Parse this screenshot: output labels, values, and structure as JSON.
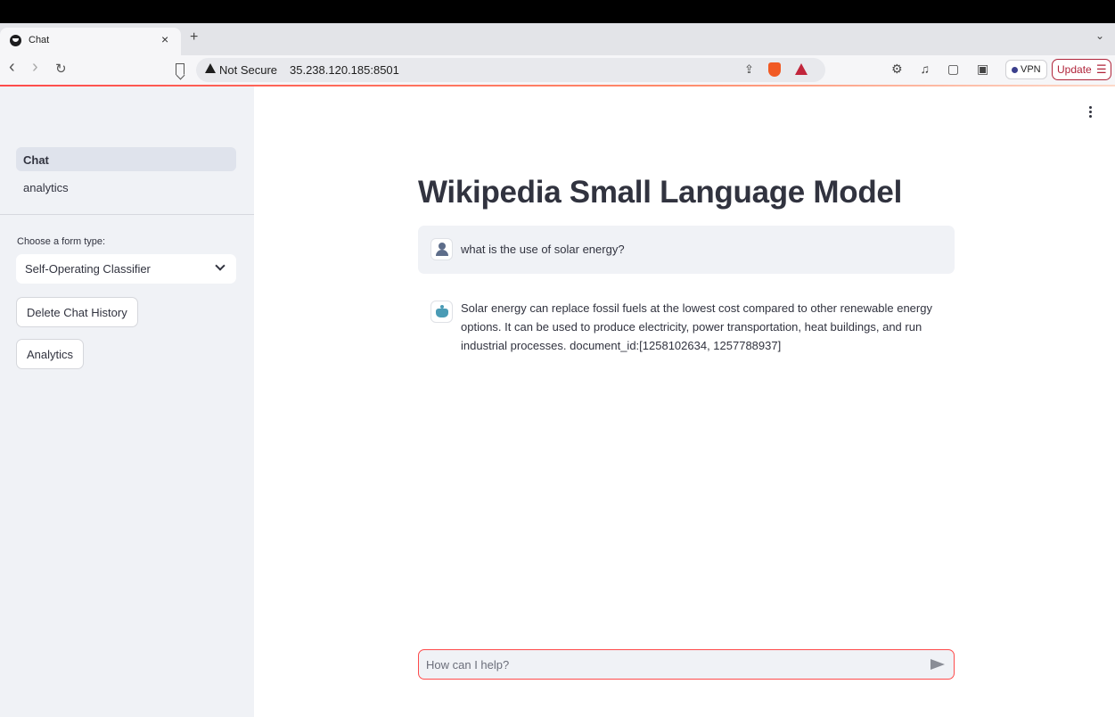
{
  "browser": {
    "tab_title": "Chat",
    "tab_close": "×",
    "new_tab": "+",
    "tab_list": "⌄",
    "back": "‹",
    "forward": "›",
    "reload": "↻",
    "security_label": "Not Secure",
    "url": "35.238.120.185:8501",
    "share": "⇪",
    "extensions": "⚙ ♫ ▢ ▣ ✧",
    "vpn_label": "VPN",
    "update_label": "Update",
    "update_menu": "☰"
  },
  "sidebar": {
    "nav_items": [
      {
        "label": "Chat",
        "active": true
      },
      {
        "label": "analytics",
        "active": false
      }
    ],
    "select_label": "Choose a form type:",
    "select_value": "Self-Operating Classifier",
    "delete_button": "Delete Chat History",
    "analytics_button": "Analytics"
  },
  "main": {
    "title": "Wikipedia Small Language Model",
    "messages": [
      {
        "role": "user",
        "text": "what is the use of solar energy?"
      },
      {
        "role": "assistant",
        "lines": [
          "Solar energy can replace fossil fuels at the lowest cost compared to other renewable energy",
          "options. It can be used to produce electricity, power transportation, heat buildings, and run",
          "industrial processes. document_id:[1258102634, 1257788937]"
        ]
      }
    ],
    "input_placeholder": "How can I help?"
  },
  "colors": {
    "accent": "#ff4b4b",
    "sidebar_bg": "#f0f2f6",
    "text": "#31333f"
  }
}
